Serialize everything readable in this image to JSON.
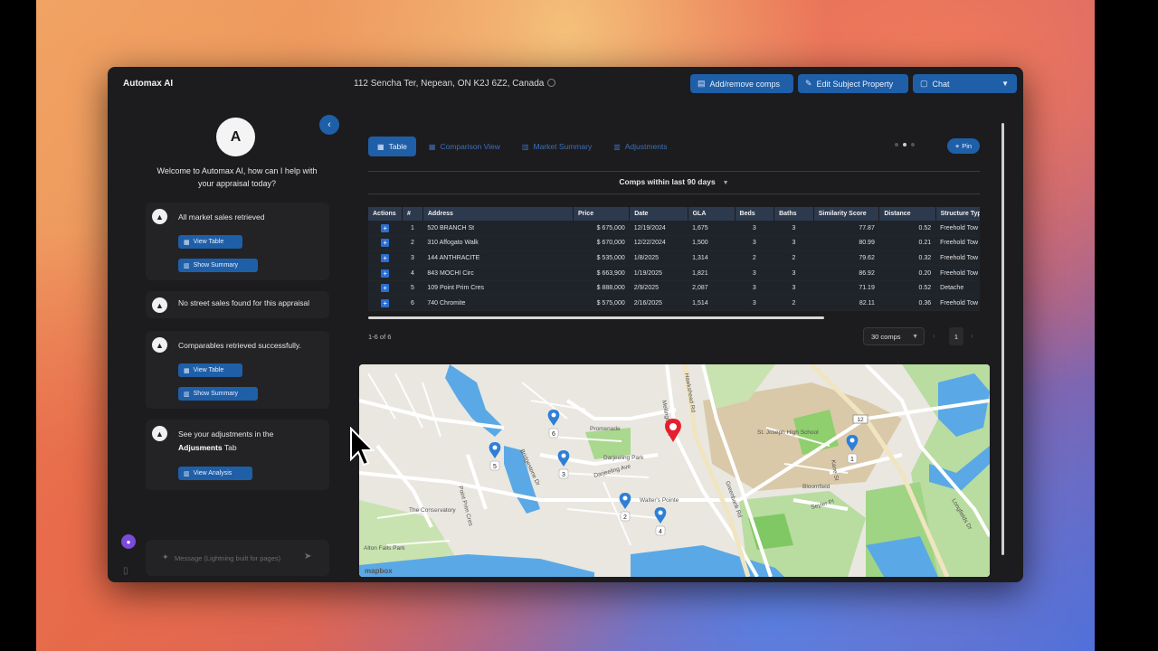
{
  "app": {
    "title": "Automax AI",
    "address": "112 Sencha Ter, Nepean, ON K2J 6Z2, Canada"
  },
  "toolbar": {
    "add_remove_comps": "Add/remove comps",
    "edit_subject": "Edit Subject Property",
    "chat": "Chat"
  },
  "chat": {
    "logo_letter": "A",
    "welcome": "Welcome to Automax AI, how can I help with your appraisal today?",
    "messages": [
      {
        "text": "All market sales retrieved",
        "buttons": [
          "View Table",
          "Show Summary"
        ]
      },
      {
        "text": "No street sales found for this appraisal"
      },
      {
        "text": "Comparables retrieved successfully.",
        "buttons": [
          "View Table",
          "Show Summary"
        ]
      },
      {
        "text_pre": "See your adjustments in the",
        "text_bold": "Adjusments",
        "text_post": "Tab",
        "buttons": [
          "View Analysis"
        ]
      }
    ],
    "input_placeholder": "Message (Lightning built for pages)"
  },
  "tabs": [
    {
      "label": "Table",
      "active": true
    },
    {
      "label": "Comparison View",
      "active": false
    },
    {
      "label": "Market Summary",
      "active": false
    },
    {
      "label": "Adjustments",
      "active": false
    }
  ],
  "pin_label": "Pin",
  "filter": {
    "label": "Comps within last 90 days"
  },
  "table": {
    "columns": [
      "Actions",
      "#",
      "Address",
      "Price",
      "Date",
      "GLA",
      "Beds",
      "Baths",
      "Similarity Score",
      "Distance",
      "Structure Type"
    ],
    "rows": [
      {
        "n": "1",
        "address": "520 BRANCH St",
        "price": "$ 675,000",
        "date": "12/19/2024",
        "gla": "1,675",
        "beds": "3",
        "baths": "3",
        "score": "77.87",
        "distance": "0.52",
        "type": "Freehold Tow"
      },
      {
        "n": "2",
        "address": "310 Affogato Walk",
        "price": "$ 670,000",
        "date": "12/22/2024",
        "gla": "1,500",
        "beds": "3",
        "baths": "3",
        "score": "80.99",
        "distance": "0.21",
        "type": "Freehold Tow"
      },
      {
        "n": "3",
        "address": "144 ANTHRACITE",
        "price": "$ 535,000",
        "date": "1/8/2025",
        "gla": "1,314",
        "beds": "2",
        "baths": "2",
        "score": "79.62",
        "distance": "0.32",
        "type": "Freehold Tow"
      },
      {
        "n": "4",
        "address": "843 MOCHI Circ",
        "price": "$ 663,900",
        "date": "1/19/2025",
        "gla": "1,821",
        "beds": "3",
        "baths": "3",
        "score": "86.92",
        "distance": "0.20",
        "type": "Freehold Tow"
      },
      {
        "n": "5",
        "address": "109 Point Prim Cres",
        "price": "$ 888,000",
        "date": "2/9/2025",
        "gla": "2,087",
        "beds": "3",
        "baths": "3",
        "score": "71.19",
        "distance": "0.52",
        "type": "Detache"
      },
      {
        "n": "6",
        "address": "740 Chromite",
        "price": "$ 575,000",
        "date": "2/16/2025",
        "gla": "1,514",
        "beds": "3",
        "baths": "2",
        "score": "82.11",
        "distance": "0.36",
        "type": "Freehold Tow"
      }
    ]
  },
  "pagination": {
    "summary": "1-6 of 6",
    "per_page": "30 comps",
    "page": "1"
  },
  "map": {
    "labels": [
      "Promenade",
      "Darjeeling Park",
      "Darjeeling Ave",
      "Walter's Pointe",
      "The Conservatory",
      "Alton Falls Park",
      "St. Joseph High School",
      "Greenbank Rd",
      "Longfields Dr",
      "Kane St",
      "Bloomfield",
      "Seyler Pl",
      "Point Prim Cres",
      "Bridgestone Dr",
      "Mellington Rd",
      "Hawkshead Rd"
    ],
    "markers": [
      "1",
      "2",
      "3",
      "4",
      "5",
      "6"
    ],
    "road_badge": "12",
    "attribution": "mapbox"
  },
  "colors": {
    "accent": "#1f5fa8",
    "subject_pin": "#e5202e",
    "comp_pin": "#2f7fd6"
  }
}
